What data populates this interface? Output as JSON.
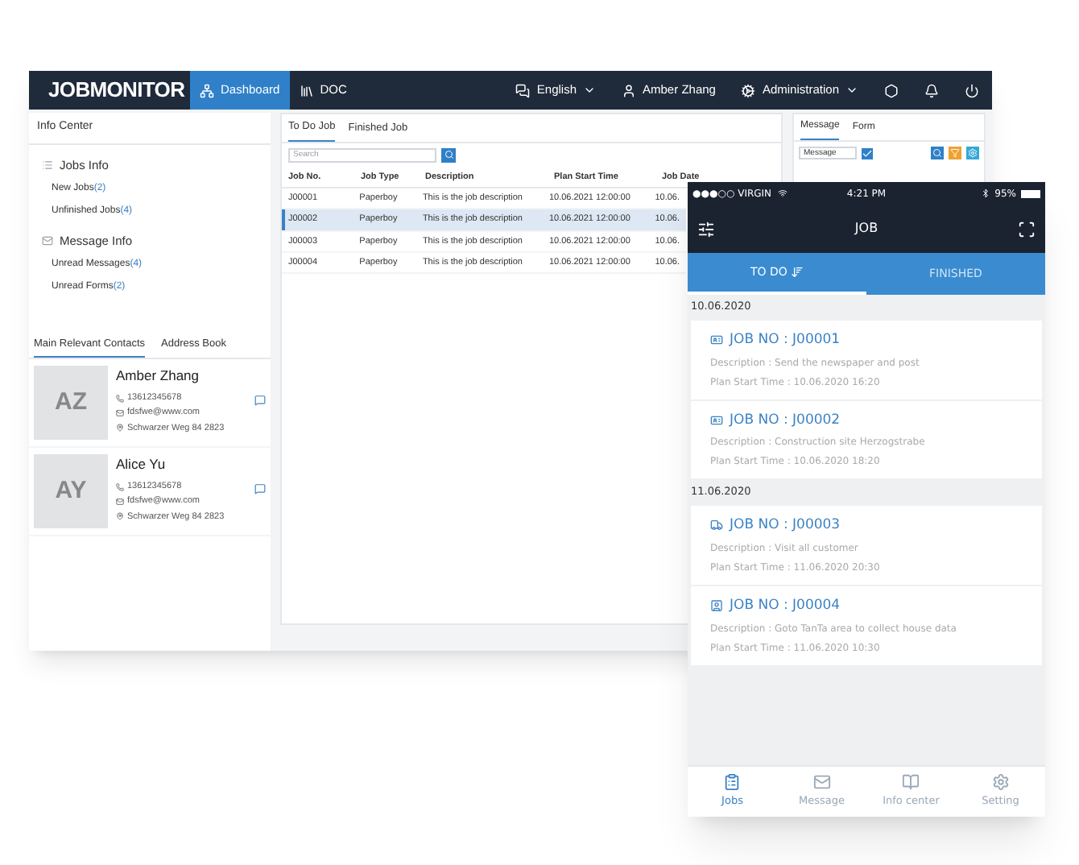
{
  "desktop": {
    "logo": "JOBMONITOR",
    "nav": [
      {
        "label": "Dashboard",
        "selected": true
      },
      {
        "label": "DOC",
        "selected": false
      }
    ],
    "language": "English",
    "user": "Amber Zhang",
    "admin": "Administration",
    "info_center": {
      "title": "Info Center",
      "groups": [
        {
          "kind": "jobs",
          "label": "Jobs Info",
          "items": [
            {
              "label": "New Jobs",
              "count": "(2)"
            },
            {
              "label": "Unfinished Jobs",
              "count": "(4)"
            }
          ]
        },
        {
          "kind": "messages",
          "label": "Message Info",
          "items": [
            {
              "label": "Unread Messages",
              "count": "(4)"
            },
            {
              "label": "Unread Forms",
              "count": "(2)"
            }
          ]
        }
      ]
    },
    "contact_tabs": [
      {
        "label": "Main Relevant Contacts",
        "selected": true
      },
      {
        "label": "Address Book",
        "selected": false
      }
    ],
    "contacts": [
      {
        "initials": "AZ",
        "name": "Amber Zhang",
        "phone": "13612345678",
        "email": "fdsfwe@www.com",
        "address": "Schwarzer Weg 84 2823"
      },
      {
        "initials": "AY",
        "name": "Alice Yu",
        "phone": "13612345678",
        "email": "fdsfwe@www.com",
        "address": "Schwarzer Weg 84 2823"
      }
    ],
    "job_tabs": [
      {
        "label": "To Do Job",
        "selected": true
      },
      {
        "label": "Finished Job",
        "selected": false
      }
    ],
    "search": {
      "placeholder": "Search"
    },
    "table": {
      "columns": [
        "Job No.",
        "Job Type",
        "Description",
        "Plan Start Time",
        "Job Date"
      ],
      "rows": [
        {
          "selected": false,
          "cells": [
            "J00001",
            "Paperboy",
            "This is the job description",
            "10.06.2021 12:00:00",
            "10.06."
          ]
        },
        {
          "selected": true,
          "cells": [
            "J00002",
            "Paperboy",
            "This is the job description",
            "10.06.2021 12:00:00",
            "10.06."
          ]
        },
        {
          "selected": false,
          "cells": [
            "J00003",
            "Paperboy",
            "This is the job description",
            "10.06.2021 12:00:00",
            "10.06."
          ]
        },
        {
          "selected": false,
          "cells": [
            "J00004",
            "Paperboy",
            "This is the job description",
            "10.06.2021 12:00:00",
            "10.06."
          ]
        }
      ]
    },
    "side_tabs": [
      {
        "label": "Message",
        "selected": true
      },
      {
        "label": "Form",
        "selected": false
      }
    ],
    "side_select": "Message"
  },
  "phone": {
    "carrier": "●●●○○ VIRGIN",
    "time": "4:21 PM",
    "battery": "95%",
    "title": "JOB",
    "tabs": [
      {
        "label": "TO DO",
        "selected": true
      },
      {
        "label": "FINISHED",
        "selected": false
      }
    ],
    "groups": [
      {
        "date": "10.06.2020",
        "jobs": [
          {
            "kind": "card",
            "title": "JOB NO : J00001",
            "description": "Description : Send the newspaper and post",
            "start": "Plan Start Time : 10.06.2020 16:20"
          },
          {
            "kind": "card",
            "title": "JOB NO : J00002",
            "description": "Description : Construction site Herzogstrabe",
            "start": "Plan Start Time : 10.06.2020 18:20"
          }
        ]
      },
      {
        "date": "11.06.2020",
        "jobs": [
          {
            "kind": "truck",
            "title": "JOB NO : J00003",
            "description": "Description : Visit all customer",
            "start": "Plan Start Time : 11.06.2020 20:30"
          },
          {
            "kind": "person",
            "title": "JOB NO : J00004",
            "description": "Description : Goto TanTa area to collect house data",
            "start": "Plan Start Time : 11.06.2020 10:30"
          }
        ]
      }
    ],
    "bottom_nav": [
      {
        "kind": "jobs",
        "label": "Jobs",
        "selected": true
      },
      {
        "kind": "message",
        "label": "Message",
        "selected": false
      },
      {
        "kind": "info",
        "label": "Info center",
        "selected": false
      },
      {
        "kind": "setting",
        "label": "Setting",
        "selected": false
      }
    ]
  }
}
